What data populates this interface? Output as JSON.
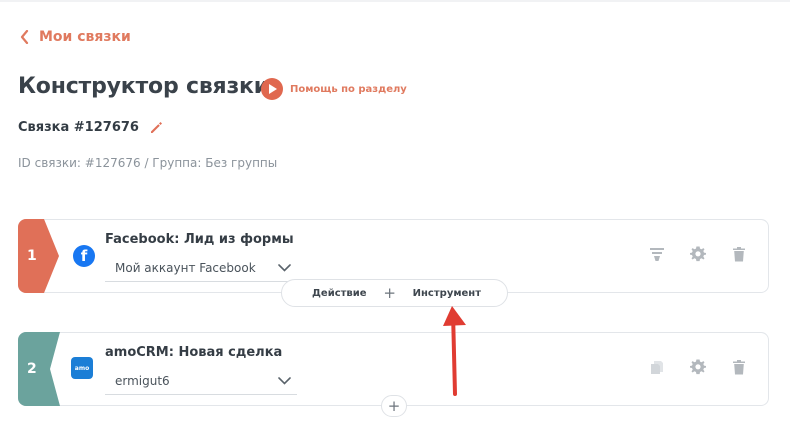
{
  "nav": {
    "back_label": "Мои связки"
  },
  "page": {
    "title": "Конструктор связки",
    "help_label": "Помощь по разделу",
    "connection_name": "Связка #127676",
    "meta": "ID связки: #127676 / Группа: Без группы"
  },
  "steps": [
    {
      "number": "1",
      "app": "facebook-icon",
      "title": "Facebook: Лид из формы",
      "account": "Мой аккаунт Facebook",
      "color": "#e07058"
    },
    {
      "number": "2",
      "app": "amocrm-icon",
      "app_icon_text": "amo",
      "title": "amoCRM: Новая сделка",
      "account": "ermigut6",
      "color": "#6ba39d"
    }
  ],
  "between": {
    "action_label": "Действие",
    "plus": "+",
    "tool_label": "Инструмент"
  },
  "add_plus": "+",
  "colors": {
    "accent": "#e07a5f",
    "arrow": "#e03c32"
  }
}
